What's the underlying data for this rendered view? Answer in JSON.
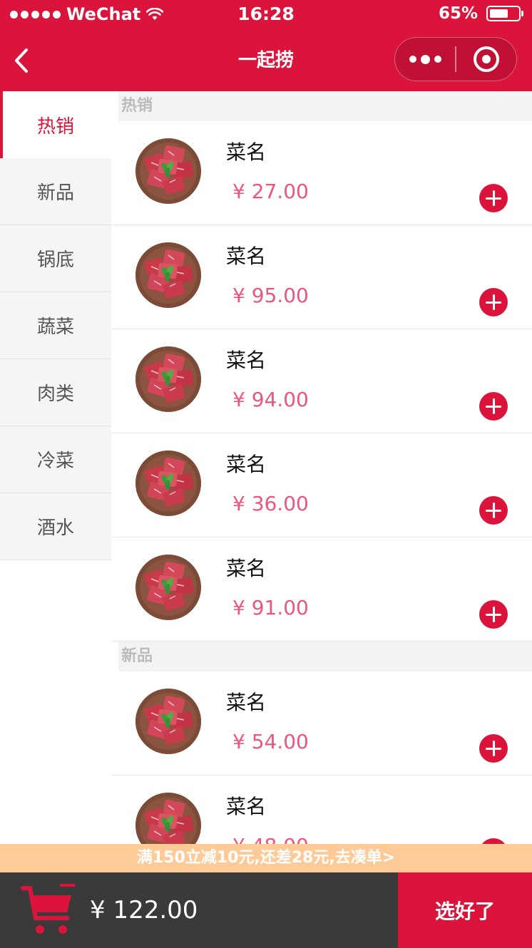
{
  "status_bar": {
    "carrier": "WeChat",
    "time": "16:28",
    "battery_text": "65%",
    "battery_level": 0.65
  },
  "nav": {
    "title": "一起捞",
    "back_icon": "chevron-left-icon",
    "more_icon": "more-dots-icon",
    "close_icon": "target-ring-icon"
  },
  "categories": [
    {
      "label": "热销",
      "active": true
    },
    {
      "label": "新品",
      "active": false
    },
    {
      "label": "锅底",
      "active": false
    },
    {
      "label": "蔬菜",
      "active": false
    },
    {
      "label": "肉类",
      "active": false
    },
    {
      "label": "冷菜",
      "active": false
    },
    {
      "label": "酒水",
      "active": false
    }
  ],
  "sections": [
    {
      "title": "热销",
      "dishes": [
        {
          "name": "菜名",
          "price": "¥ 27.00"
        },
        {
          "name": "菜名",
          "price": "¥ 95.00"
        },
        {
          "name": "菜名",
          "price": "¥ 94.00"
        },
        {
          "name": "菜名",
          "price": "¥ 36.00"
        },
        {
          "name": "菜名",
          "price": "¥ 91.00"
        }
      ]
    },
    {
      "title": "新品",
      "dishes": [
        {
          "name": "菜名",
          "price": "¥ 54.00"
        },
        {
          "name": "菜名",
          "price": "¥ 48.00"
        }
      ]
    }
  ],
  "promo": {
    "text": "满150立减10元,还差28元,去凑单>"
  },
  "cart": {
    "total": "¥ 122.00",
    "checkout_label": "选好了",
    "icon": "shopping-cart-icon"
  },
  "colors": {
    "brand_red": "#db143c",
    "price_pink": "#e9567e",
    "promo_orange": "#fecb98",
    "cart_bar": "#3a3a3a"
  }
}
